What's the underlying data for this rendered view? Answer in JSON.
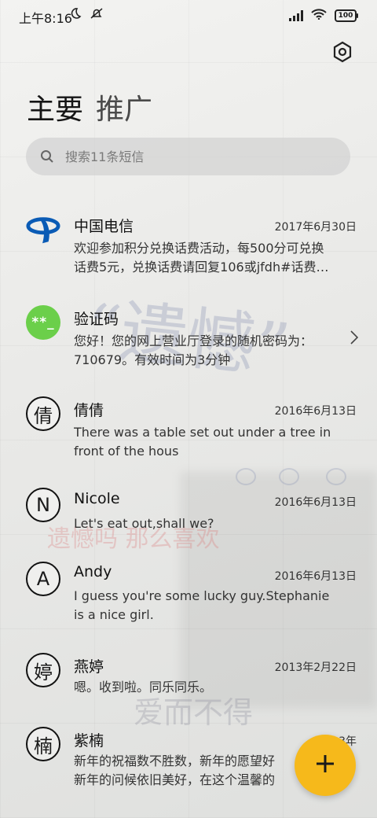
{
  "status_bar": {
    "time": "上午8:16",
    "battery": "100"
  },
  "tabs": [
    {
      "label": "主要"
    },
    {
      "label": "推广"
    }
  ],
  "search": {
    "placeholder": "搜索11条短信"
  },
  "conversations": [
    {
      "name": "中国电信",
      "date": "2017年6月30日",
      "line1": "欢迎参加积分兑换话费活动，每500分可兑换",
      "line2": "话费5元，兑换话费请回复106或jfdh#话费…",
      "avatar": "china-telecom-logo"
    },
    {
      "name": "验证码",
      "date": "",
      "line1": "您好！您的网上营业厅登录的随机密码为：",
      "line2": "710679。有效时间为3分钟",
      "avatar_text": "**_"
    },
    {
      "name": "倩倩",
      "date": "2016年6月13日",
      "line1": "There was a table set out under a tree in",
      "line2": "front of the hous",
      "avatar_text": "倩"
    },
    {
      "name": "Nicole",
      "date": "2016年6月13日",
      "line1": "Let's eat out,shall we?",
      "line2": "",
      "avatar_text": "N"
    },
    {
      "name": "Andy",
      "date": "2016年6月13日",
      "line1": "I guess you're some lucky guy.Stephanie",
      "line2": "is a nice girl.",
      "avatar_text": "A"
    },
    {
      "name": "燕婷",
      "date": "2013年2月22日",
      "line1": "嗯。收到啦。同乐同乐。",
      "line2": "",
      "avatar_text": "婷"
    },
    {
      "name": "紫楠",
      "date": "2013年",
      "line1": "新年的祝福数不胜数，新年的愿望好",
      "line2": "新年的问候依旧美好，在这个温馨的",
      "avatar_text": "楠"
    }
  ],
  "fab": {
    "label": "+"
  },
  "colors": {
    "fab": "#f6b91b",
    "verify_avatar": "#6bcf4a",
    "telecom_blue": "#0a5bb5"
  }
}
